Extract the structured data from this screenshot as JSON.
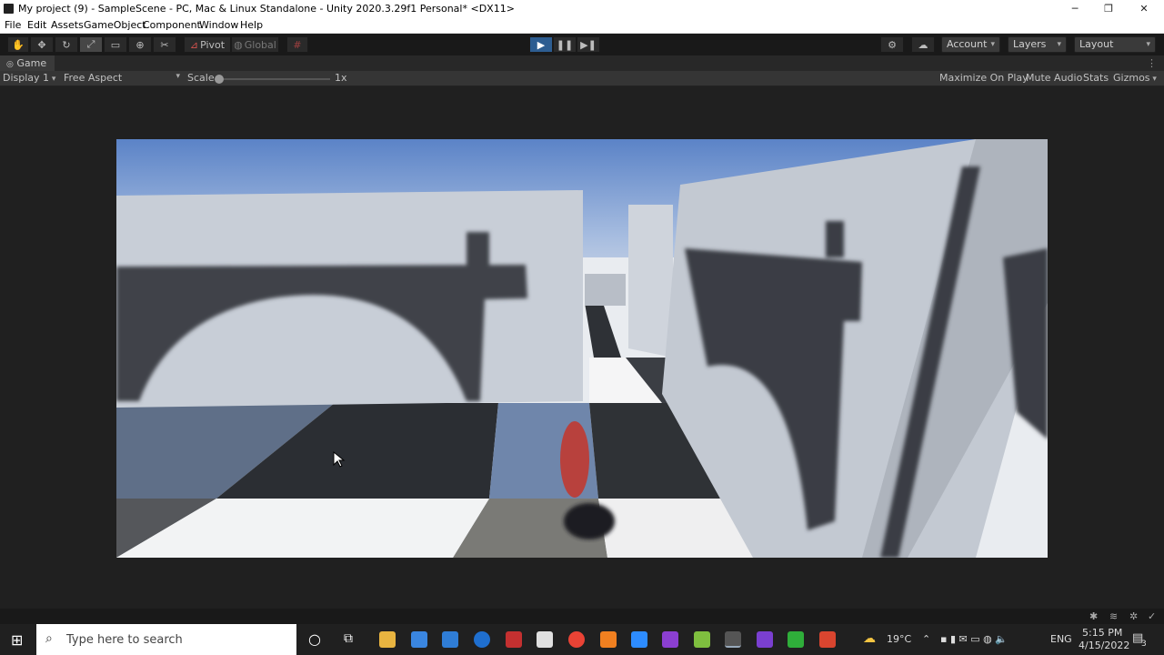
{
  "window": {
    "title": "My project (9) - SampleScene - PC, Mac & Linux Standalone - Unity 2020.3.29f1 Personal* <DX11>",
    "minimize": "─",
    "restore": "❐",
    "close": "✕"
  },
  "menu": [
    "File",
    "Edit",
    "Assets",
    "GameObject",
    "Component",
    "Window",
    "Help"
  ],
  "toolbar": {
    "pivot": "Pivot",
    "global": "Global",
    "account": "Account",
    "layers": "Layers",
    "layout": "Layout"
  },
  "tab": {
    "label": "Game"
  },
  "gamebar": {
    "display": "Display 1",
    "aspect": "Free Aspect",
    "scale_label": "Scale",
    "scale_value": "1x",
    "scale_level": 0.0,
    "maximize": "Maximize On Play",
    "mute": "Mute Audio",
    "stats": "Stats",
    "gizmos": "Gizmos"
  },
  "taskbar": {
    "search_placeholder": "Type here to search",
    "weather": "19°C",
    "language": "ENG",
    "time": "5:15 PM",
    "date": "4/15/2022",
    "notification_count": "3"
  },
  "colors": {
    "play_active": "#2d5d91",
    "ball": "#b8413d",
    "sky_top": "#5b83c7",
    "wall": "#c9cfd8",
    "shadow": "#3e4146"
  }
}
